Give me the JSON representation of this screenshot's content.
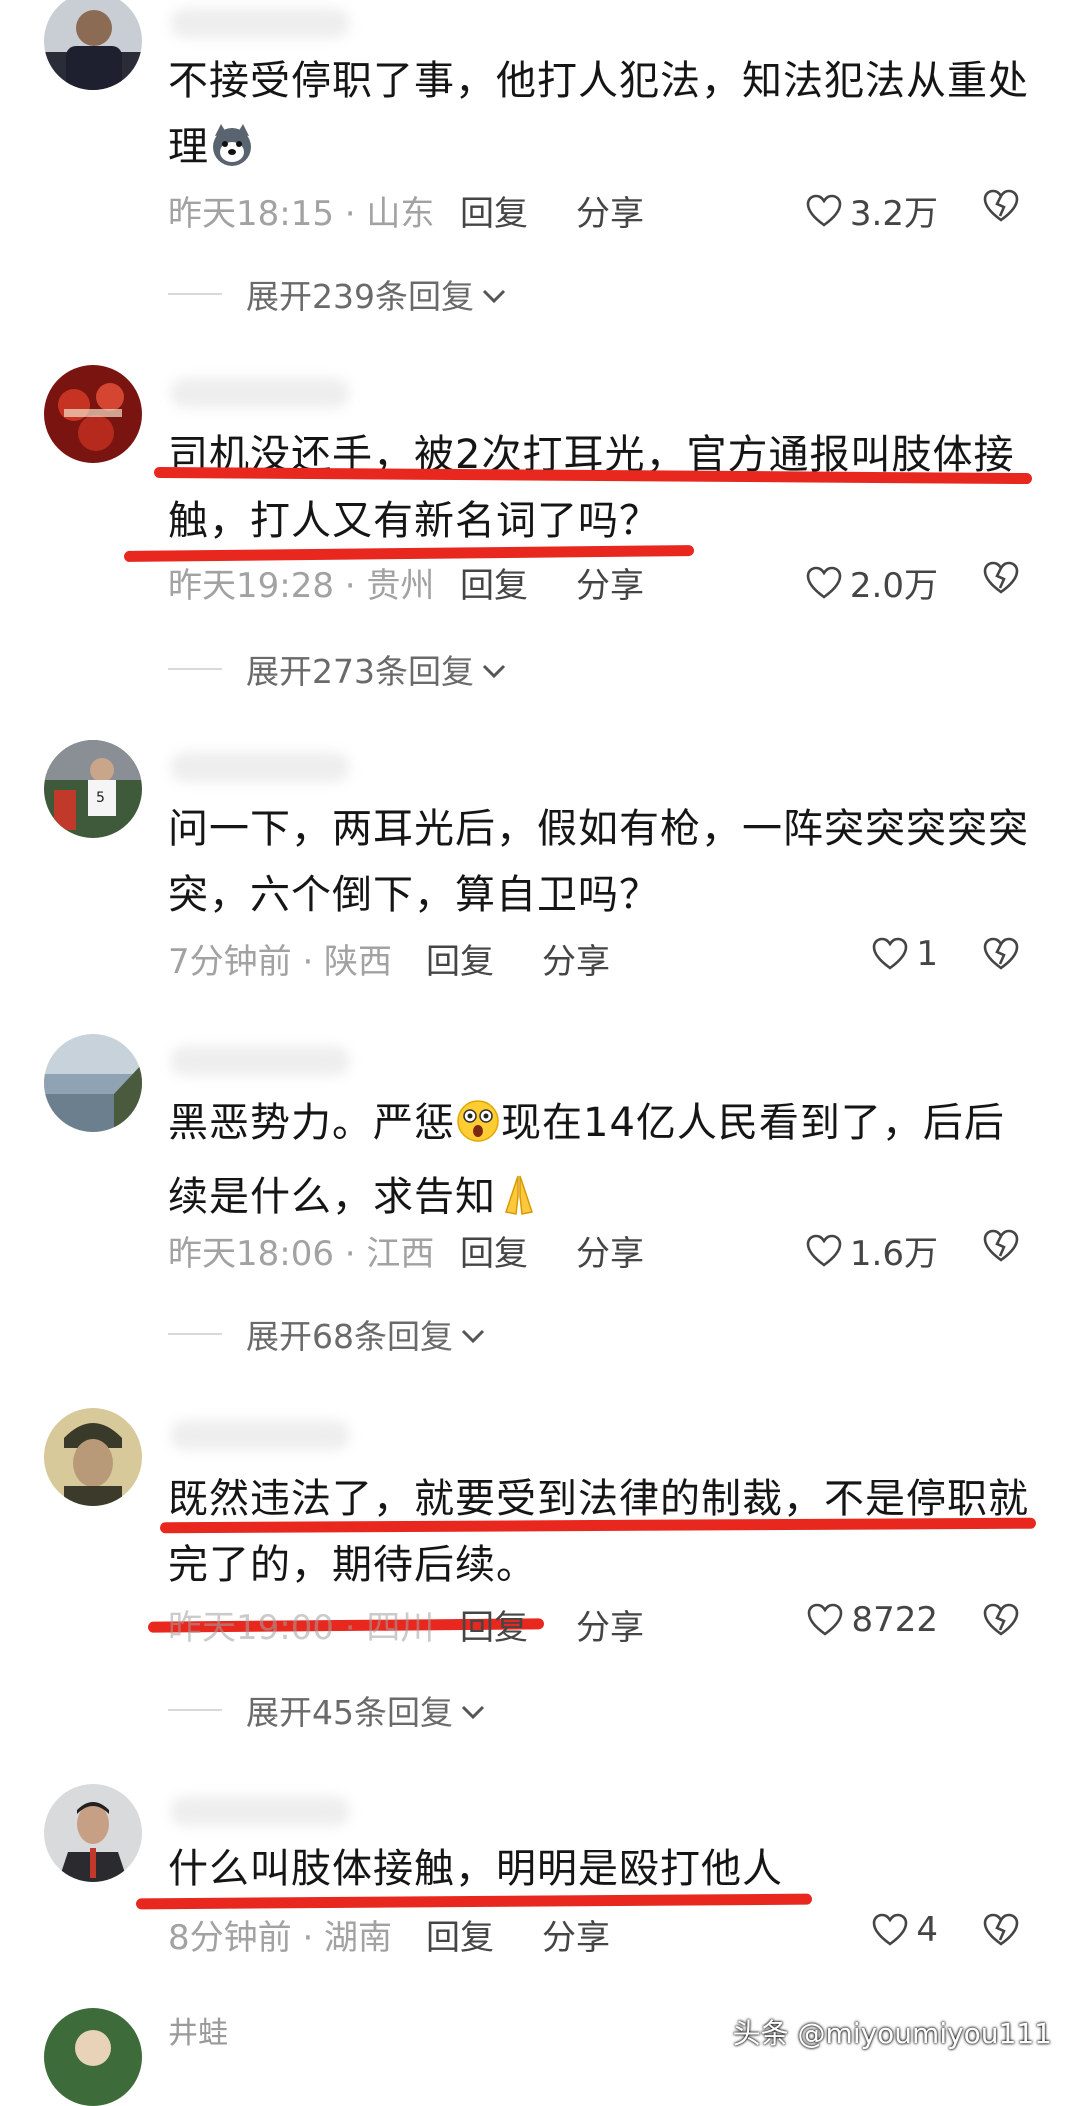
{
  "comments": [
    {
      "text_lines": [
        "不接受停职了事，他打人犯法，知法犯法从重处",
        "理"
      ],
      "time_location": "昨天18:15 · 山东",
      "reply_label": "回复",
      "share_label": "分享",
      "likes": "3.2万",
      "expand_label": "展开239条回复",
      "emoji": "dog-face-emoji"
    },
    {
      "text_lines": [
        "司机没还手，被2次打耳光，官方通报叫肢体接",
        "触，打人又有新名词了吗？"
      ],
      "time_location": "昨天19:28 · 贵州",
      "reply_label": "回复",
      "share_label": "分享",
      "likes": "2.0万",
      "expand_label": "展开273条回复"
    },
    {
      "text_lines": [
        "问一下，两耳光后，假如有枪，一阵突突突突突",
        "突，六个倒下，算自卫吗？"
      ],
      "time_location": "7分钟前 · 陕西",
      "reply_label": "回复",
      "share_label": "分享",
      "likes": "1"
    },
    {
      "text_lines_parts": {
        "line1_a": "黑恶势力。严惩",
        "line1_b": "现在14亿人民看到了，后后",
        "line2": "续是什么，求告知"
      },
      "time_location": "昨天18:06 · 江西",
      "reply_label": "回复",
      "share_label": "分享",
      "likes": "1.6万",
      "expand_label": "展开68条回复"
    },
    {
      "text_lines": [
        "既然违法了，就要受到法律的制裁，不是停职就",
        "完了的，期待后续。"
      ],
      "time_location": "昨天19:00 · 四川",
      "reply_label": "回复",
      "share_label": "分享",
      "likes": "8722",
      "expand_label": "展开45条回复"
    },
    {
      "text_lines": [
        "什么叫肢体接触，明明是殴打他人"
      ],
      "time_location": "8分钟前 · 湖南",
      "reply_label": "回复",
      "share_label": "分享",
      "likes": "4"
    },
    {
      "username": "井蛙"
    }
  ],
  "watermark": "头条 @miyoumiyou111",
  "colors": {
    "underline": "#e8281e",
    "meta_gray": "#a2a2a2",
    "text": "#151515"
  }
}
